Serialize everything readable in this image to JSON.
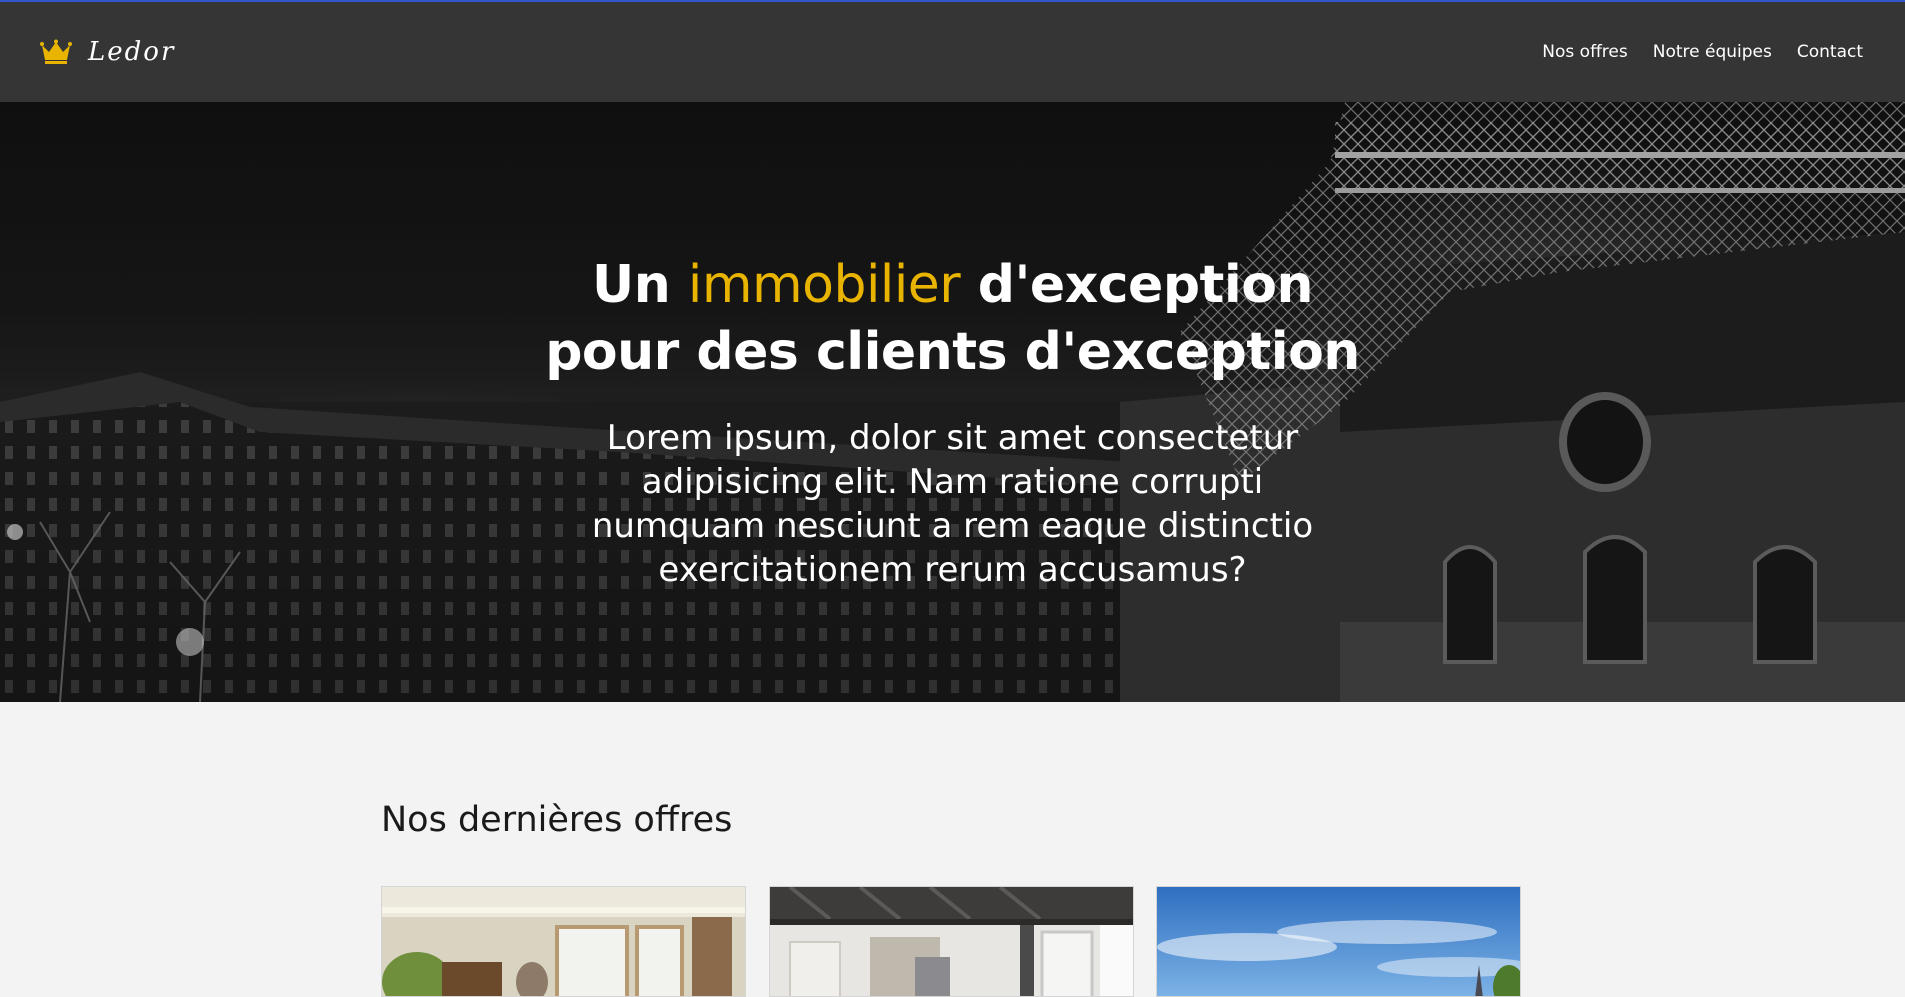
{
  "colors": {
    "accent": "#e8b400",
    "header_bg": "#353535",
    "page_bg": "#f3f3f3"
  },
  "header": {
    "logo_icon": "crown-icon",
    "logo_text": "Ledor",
    "nav": [
      "Nos offres",
      "Notre équipes",
      "Contact"
    ]
  },
  "hero": {
    "title_part1": "Un",
    "title_accent": "immobilier",
    "title_part2": "d'exception",
    "title_line2": "pour des clients d'exception",
    "text": "Lorem ipsum, dolor sit amet consectetur adipisicing elit. Nam ratione corrupti numquam nesciunt a rem eaque distinctio exercitationem rerum accusamus?"
  },
  "offers": {
    "title": "Nos dernières offres"
  }
}
